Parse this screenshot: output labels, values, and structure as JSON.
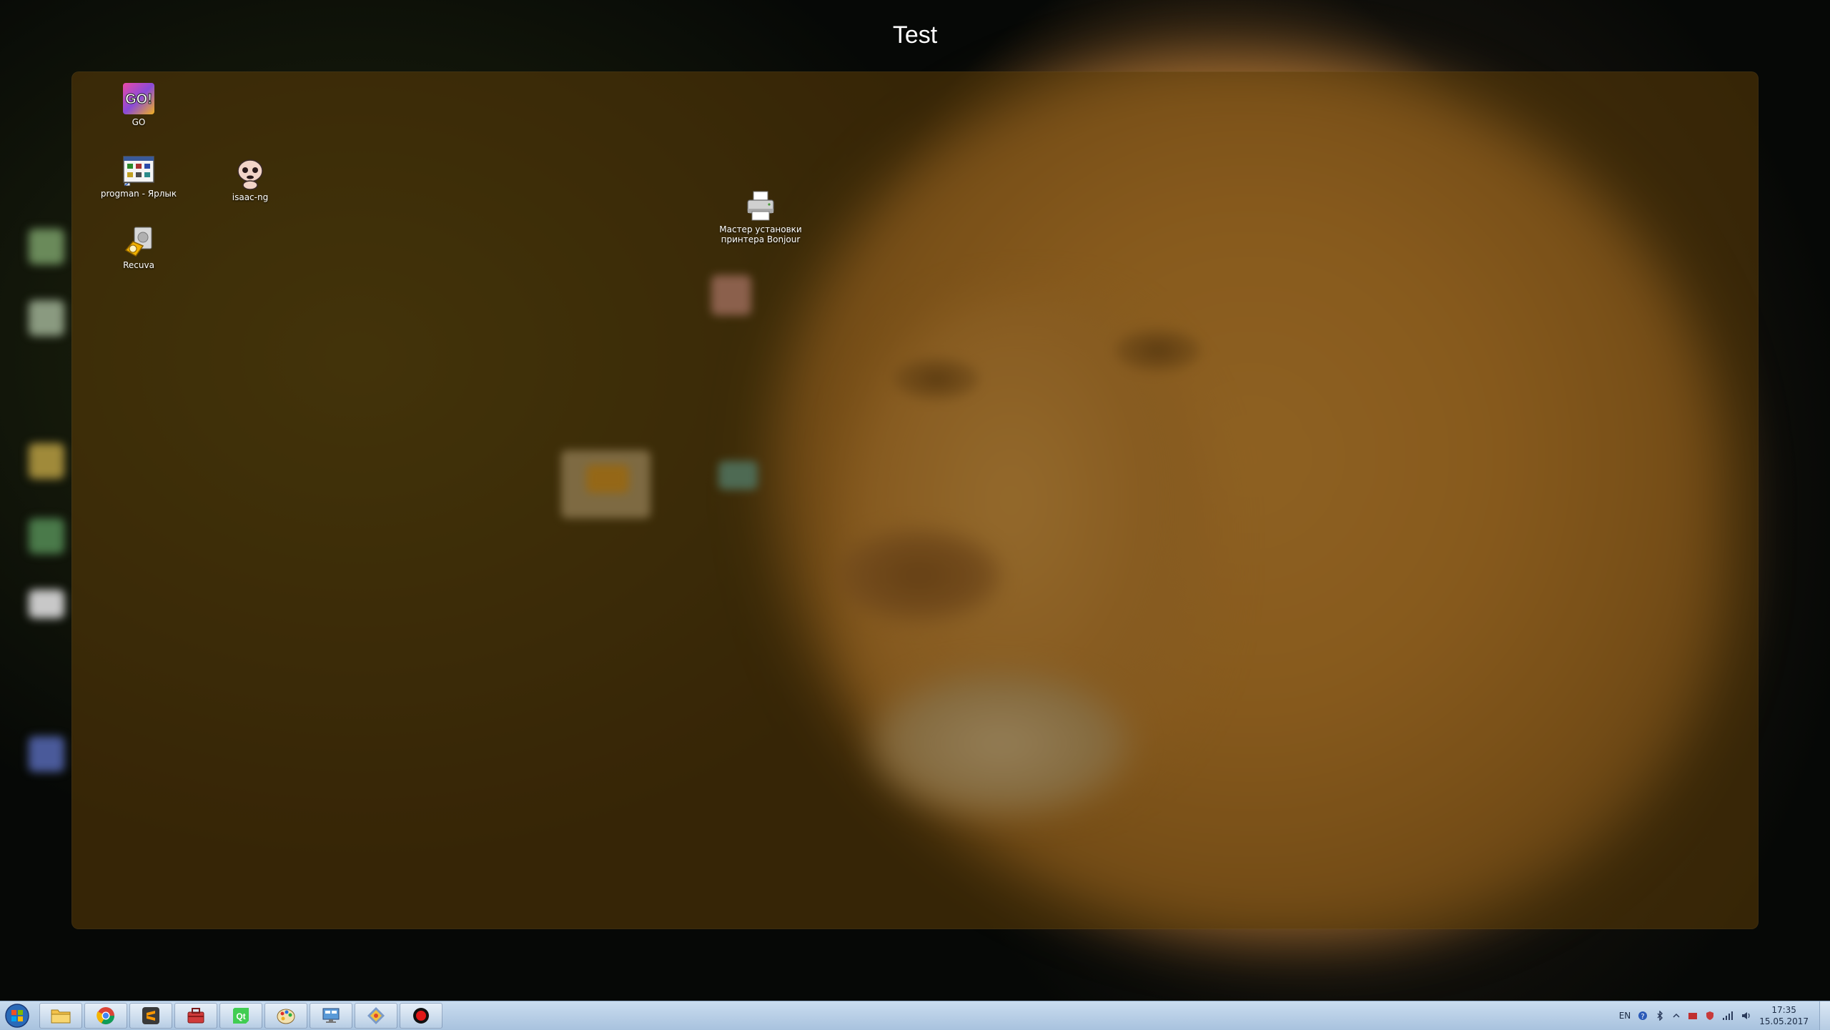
{
  "window": {
    "title": "Test"
  },
  "desktop_icons": [
    {
      "label": "GO",
      "icon": "go-app-icon"
    },
    {
      "label": "progman - Ярлык",
      "icon": "progman-shortcut-icon"
    },
    {
      "label": "isaac-ng",
      "icon": "isaac-ng-icon"
    },
    {
      "label": "Recuva",
      "icon": "recuva-icon"
    },
    {
      "label": "Мастер установки\nпринтера Bonjour",
      "icon": "printer-icon"
    }
  ],
  "taskbar": {
    "start": "windows-start-orb",
    "pinned": [
      {
        "name": "explorer",
        "icon": "folder-icon"
      },
      {
        "name": "chrome",
        "icon": "chrome-icon"
      },
      {
        "name": "sublime-text",
        "icon": "sublime-icon"
      },
      {
        "name": "toolbox",
        "icon": "toolbox-icon"
      },
      {
        "name": "qt-creator",
        "icon": "qt-icon"
      },
      {
        "name": "paint",
        "icon": "paint-icon"
      },
      {
        "name": "remote-desktop",
        "icon": "monitor-icon"
      },
      {
        "name": "git-extensions",
        "icon": "git-icon"
      },
      {
        "name": "recorder",
        "icon": "record-icon"
      }
    ],
    "tray": {
      "language": "EN",
      "time": "17:35",
      "date": "15.05.2017"
    }
  },
  "colors": {
    "overlay": "#5f3e08",
    "taskbar": "#b7cde5",
    "title_text": "#ffffff"
  }
}
